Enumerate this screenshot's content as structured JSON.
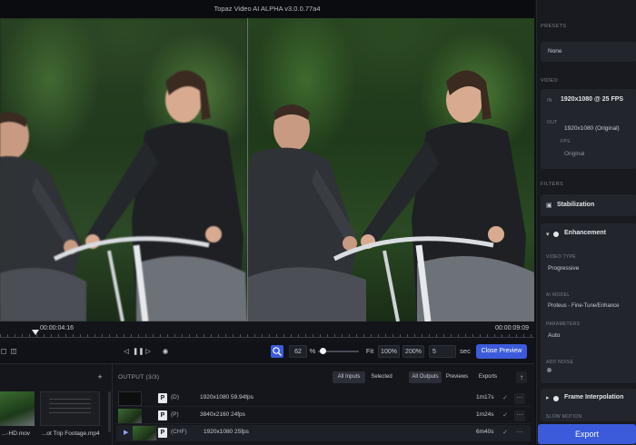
{
  "window": {
    "title": "Topaz Video AI ALPHA  v3.0.0.77a4"
  },
  "timeline": {
    "current_time": "00:00:04:16",
    "end_time": "00:00:09:09"
  },
  "controls": {
    "zoom_value": "62",
    "zoom_unit": "%",
    "fit_label": "Fit",
    "zoom_100": "100%",
    "zoom_200": "200%",
    "seconds_value": "5",
    "seconds_unit": "sec",
    "close_preview_label": "Close Preview",
    "prev_frame": "◁",
    "play_icon": "▶",
    "pause_icon": "❚❚",
    "next_frame": "▷",
    "record_icon": "◉",
    "left_icon_a": "▢",
    "left_icon_b": "◫"
  },
  "inputs": {
    "add_label": "+",
    "files": [
      {
        "name": "...-HD.mov"
      },
      {
        "name": "...ot Trip Footage.mp4"
      }
    ]
  },
  "output": {
    "title": "OUTPUT (3/3)",
    "tabs": {
      "all_inputs": "All Inputs",
      "selected": "Selected",
      "all_outputs": "All Outputs",
      "previews": "Previews",
      "exports": "Exports",
      "arrow": "↑"
    },
    "rows": [
      {
        "p": "P",
        "sub": "(D)",
        "res": "1920x1080   59.94fps",
        "dur": "1m17s",
        "check": "✓",
        "more": "⋯"
      },
      {
        "p": "P",
        "sub": "(P)",
        "res": "3840x2160   24fps",
        "dur": "1m24s",
        "check": "✓",
        "more": "⋯"
      },
      {
        "p": "P",
        "sub": "(CHF)",
        "res": "1920x1080   25fps",
        "dur": "6m40s",
        "check": "✓",
        "more": "⋯"
      }
    ]
  },
  "sidebar": {
    "presets_head": "PRESETS",
    "preset_value": "None",
    "video_head": "VIDEO",
    "in_label": "IN",
    "in_value": "1920x1080 @ 25 FPS",
    "out_label": "OUT",
    "out_value": "1920x1080 (Original)",
    "fps_label": "FPS",
    "fps_value": "Original",
    "filters_head": "FILTERS",
    "stabilization": "Stabilization",
    "enhancement": "Enhancement",
    "video_type_label": "VIDEO TYPE",
    "video_type_value": "Progressive",
    "ai_model_label": "AI MODEL",
    "ai_model_value": "Proteus - Fine-Tune/Enhance",
    "parameters_label": "PARAMETERS",
    "parameters_value": "Auto",
    "add_noise_label": "ADD NOISE",
    "frame_interp": "Frame Interpolation",
    "slow_motion_label": "SLOW MOTION",
    "export_label": "Export"
  }
}
